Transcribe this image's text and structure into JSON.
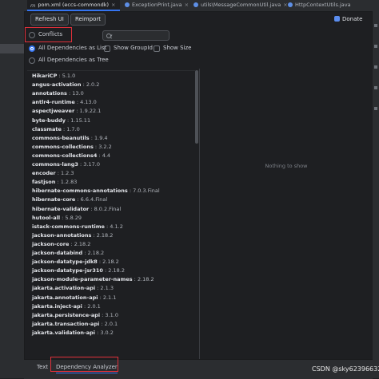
{
  "tabs": [
    {
      "label": "pom.xml (eccs-commondk)",
      "active": true
    },
    {
      "label": "ExceptionPrint.java",
      "active": false
    },
    {
      "label": "utils\\MessageCommonUtil.java",
      "active": false
    },
    {
      "label": "HttpContextUtils.java",
      "active": false
    }
  ],
  "toolbar": {
    "refresh_label": "Refresh UI",
    "reimport_label": "Reimport",
    "donate_label": "Donate"
  },
  "filters": {
    "conflicts_label": "Conflicts",
    "search_value": "",
    "search_placeholder": "",
    "list_label": "All Dependencies as List",
    "show_groupid_label": "Show GroupId",
    "show_size_label": "Show Size",
    "tree_label": "All Dependencies as Tree",
    "mode_selected": "list"
  },
  "dependencies": [
    {
      "name": "HikariCP",
      "version": "5.1.0"
    },
    {
      "name": "angus-activation",
      "version": "2.0.2"
    },
    {
      "name": "annotations",
      "version": "13.0"
    },
    {
      "name": "antlr4-runtime",
      "version": "4.13.0"
    },
    {
      "name": "aspectjweaver",
      "version": "1.9.22.1"
    },
    {
      "name": "byte-buddy",
      "version": "1.15.11"
    },
    {
      "name": "classmate",
      "version": "1.7.0"
    },
    {
      "name": "commons-beanutils",
      "version": "1.9.4"
    },
    {
      "name": "commons-collections",
      "version": "3.2.2"
    },
    {
      "name": "commons-collections4",
      "version": "4.4"
    },
    {
      "name": "commons-lang3",
      "version": "3.17.0"
    },
    {
      "name": "encoder",
      "version": "1.2.3"
    },
    {
      "name": "fastjson",
      "version": "1.2.83"
    },
    {
      "name": "hibernate-commons-annotations",
      "version": "7.0.3.Final"
    },
    {
      "name": "hibernate-core",
      "version": "6.6.4.Final"
    },
    {
      "name": "hibernate-validator",
      "version": "8.0.2.Final"
    },
    {
      "name": "hutool-all",
      "version": "5.8.29"
    },
    {
      "name": "istack-commons-runtime",
      "version": "4.1.2"
    },
    {
      "name": "jackson-annotations",
      "version": "2.18.2"
    },
    {
      "name": "jackson-core",
      "version": "2.18.2"
    },
    {
      "name": "jackson-databind",
      "version": "2.18.2"
    },
    {
      "name": "jackson-datatype-jdk8",
      "version": "2.18.2"
    },
    {
      "name": "jackson-datatype-jsr310",
      "version": "2.18.2"
    },
    {
      "name": "jackson-module-parameter-names",
      "version": "2.18.2"
    },
    {
      "name": "jakarta.activation-api",
      "version": "2.1.3"
    },
    {
      "name": "jakarta.annotation-api",
      "version": "2.1.1"
    },
    {
      "name": "jakarta.inject-api",
      "version": "2.0.1"
    },
    {
      "name": "jakarta.persistence-api",
      "version": "3.1.0"
    },
    {
      "name": "jakarta.transaction-api",
      "version": "2.0.1"
    },
    {
      "name": "jakarta.validation-api",
      "version": "3.0.2"
    }
  ],
  "detail": {
    "empty_text": "Nothing to show"
  },
  "bottom_tabs": [
    {
      "label": "Text",
      "active": false
    },
    {
      "label": "Dependency Analyzer",
      "active": true
    }
  ],
  "watermark": "CSDN @sky623966322",
  "colors": {
    "accent": "#3574f0",
    "highlight_box": "#e0303a",
    "background": "#1e1f22"
  }
}
